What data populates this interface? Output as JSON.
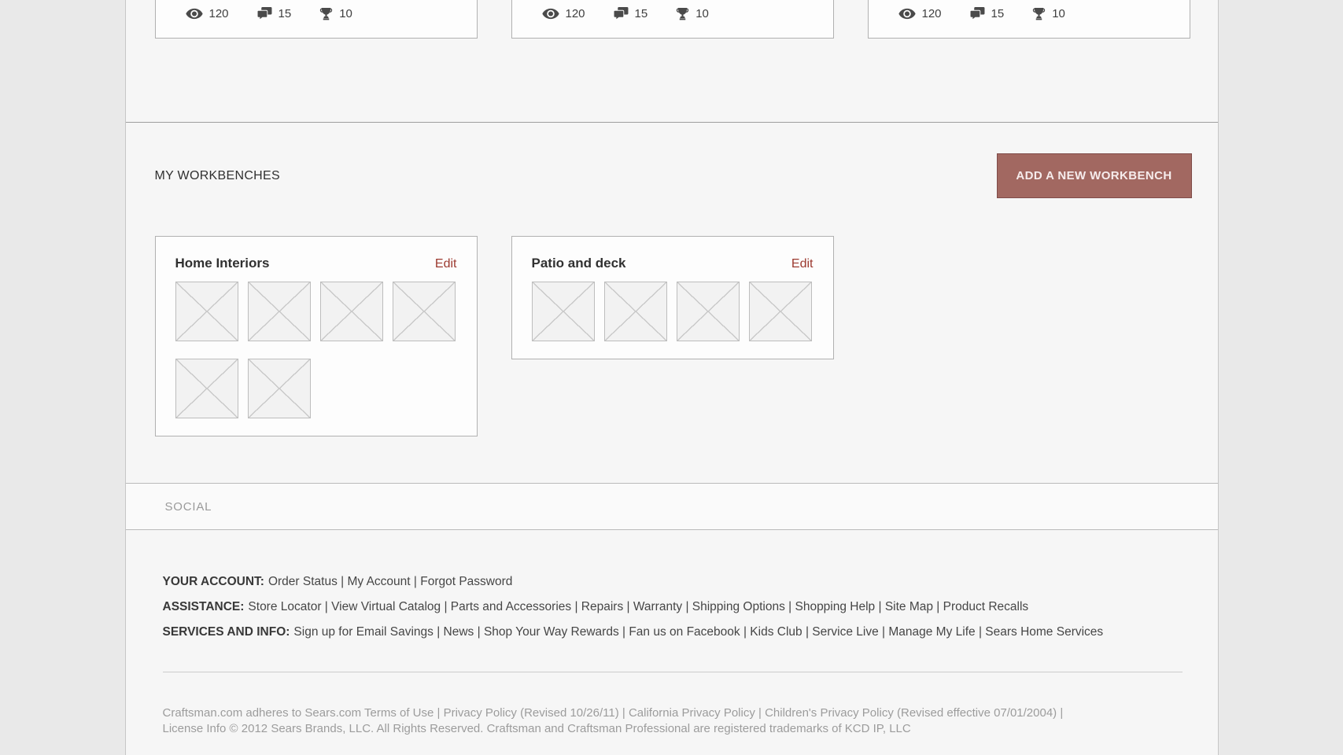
{
  "colors": {
    "accent_button": "#a26861",
    "accent_button_border": "#7f4c49",
    "edit_link": "#9c392f",
    "page_background": "#e9e9e9"
  },
  "top_cards": [
    {
      "views": "120",
      "comments": "15",
      "trophies": "10"
    },
    {
      "views": "120",
      "comments": "15",
      "trophies": "10"
    },
    {
      "views": "120",
      "comments": "15",
      "trophies": "10"
    }
  ],
  "workbench_section": {
    "title": "MY WORKBENCHES",
    "add_button_label": "ADD A NEW WORKBENCH"
  },
  "workbenches": [
    {
      "title": "Home Interiors",
      "edit_label": "Edit",
      "placeholder_count": 6
    },
    {
      "title": "Patio and deck",
      "edit_label": "Edit",
      "placeholder_count": 4
    }
  ],
  "social": {
    "label": "SOCIAL"
  },
  "footer": {
    "separator": "|",
    "link_groups": [
      {
        "label": "YOUR ACCOUNT:",
        "links": [
          "Order Status",
          "My Account",
          "Forgot Password"
        ]
      },
      {
        "label": "ASSISTANCE:",
        "links": [
          "Store Locator",
          "View Virtual Catalog",
          "Parts and Accessories",
          "Repairs",
          "Warranty",
          "Shipping Options",
          "Shopping Help",
          "Site Map",
          "Product Recalls"
        ]
      },
      {
        "label": "SERVICES AND INFO:",
        "links": [
          "Sign up for Email Savings",
          "News",
          "Shop Your Way Rewards",
          "Fan us on Facebook",
          "Kids Club",
          "Service Live",
          "Manage My Life",
          "Sears Home Services"
        ]
      }
    ],
    "legal_lines": [
      "Craftsman.com adheres to Sears.com Terms of Use | Privacy Policy (Revised 10/26/11) | California Privacy Policy | Children's Privacy Policy (Revised effective 07/01/2004) |",
      "License Info © 2012 Sears Brands, LLC. All Rights Reserved. Craftsman and Craftsman Professional are registered trademarks of KCD IP, LLC"
    ]
  }
}
